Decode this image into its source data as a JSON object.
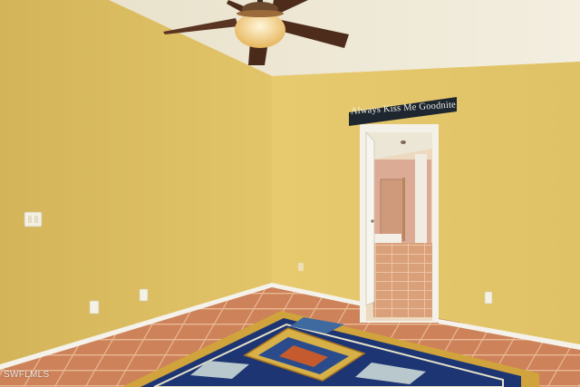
{
  "scene": {
    "sign": {
      "text": "Always Kiss Me Goodnite"
    },
    "watermark": {
      "text": "SWFLMLS"
    },
    "colors": {
      "left_wall": "#d9bc5e",
      "back_wall": "#e6c86c",
      "ceiling": "#f0ead8",
      "floor_tile": "#c97e58",
      "grout": "#e8b892",
      "rug_border": "#d0a33c",
      "rug_field": "#1d3572",
      "baseboard": "#f4f2ea",
      "sign_board": "#1e2630"
    },
    "icons": [
      "ceiling-fan-icon",
      "light-switch-icon",
      "outlet-icon"
    ]
  }
}
